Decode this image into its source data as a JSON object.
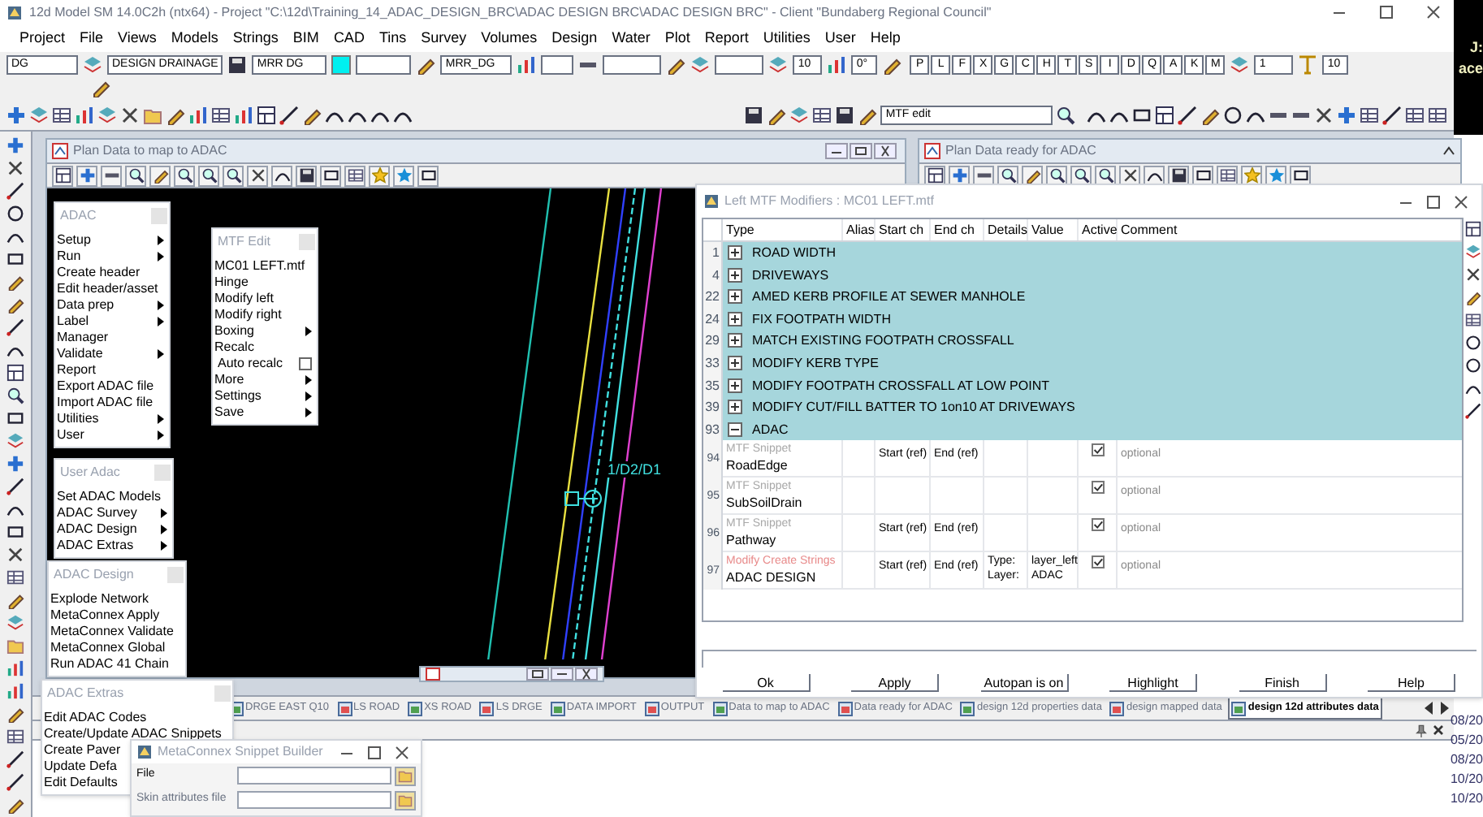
{
  "window": {
    "title": "12d Model SM 14.0C2h (ntx64) - Project \"C:\\12d\\Training_14_ADAC_DESIGN_BRC\\ADAC DESIGN BRC\\ADAC DESIGN BRC\" - Client \"Bundaberg Regional Council\""
  },
  "menu": [
    "Project",
    "File",
    "Views",
    "Models",
    "Strings",
    "BIM",
    "CAD",
    "Tins",
    "Survey",
    "Volumes",
    "Design",
    "Water",
    "Plot",
    "Report",
    "Utilities",
    "User",
    "Help"
  ],
  "attribute_fields": [
    "DG",
    "DESIGN DRAINAGE",
    "MRR DG",
    "MRR_DG",
    "10",
    "0°",
    "1",
    "10"
  ],
  "letter_buttons": [
    "P",
    "L",
    "F",
    "X",
    "G",
    "C",
    "H",
    "T",
    "S",
    "I",
    "D",
    "Q",
    "A",
    "K",
    "M"
  ],
  "mtf_search": {
    "value": "MTF edit"
  },
  "plan_windows": [
    {
      "title": "Plan Data to map to ADAC",
      "canvas_label": "1/D2/D1"
    },
    {
      "title": "Plan Data ready for ADAC"
    }
  ],
  "menus": [
    {
      "title": "ADAC",
      "items": [
        {
          "label": "Setup",
          "submenu": true
        },
        {
          "label": "Run",
          "submenu": true
        },
        {
          "label": "Create header",
          "submenu": false
        },
        {
          "label": "Edit header/asset",
          "submenu": false
        },
        {
          "label": "Data prep",
          "submenu": true
        },
        {
          "label": "Label",
          "submenu": true
        },
        {
          "label": "Manager",
          "submenu": false
        },
        {
          "label": "Validate",
          "submenu": true
        },
        {
          "label": "Report",
          "submenu": false
        },
        {
          "label": "Export ADAC file",
          "submenu": false
        },
        {
          "label": "Import ADAC file",
          "submenu": false
        },
        {
          "label": "Utilities",
          "submenu": true
        },
        {
          "label": "User",
          "submenu": true
        }
      ]
    },
    {
      "title": "MTF Edit",
      "items": [
        {
          "label": "MC01 LEFT.mtf",
          "kind": "item",
          "submenu": false
        },
        {
          "label": "Hinge",
          "kind": "item",
          "submenu": false
        },
        {
          "label": "Modify left",
          "kind": "item",
          "submenu": false
        },
        {
          "label": "Modify right",
          "kind": "item",
          "submenu": false
        },
        {
          "label": "Boxing",
          "kind": "item",
          "submenu": true
        },
        {
          "label": "Recalc",
          "kind": "item",
          "submenu": false
        },
        {
          "label": "Auto recalc",
          "kind": "checkbox",
          "checked": false
        },
        {
          "label": "More",
          "kind": "item",
          "submenu": true
        },
        {
          "label": "Settings",
          "kind": "item",
          "submenu": true
        },
        {
          "label": "Save",
          "kind": "item",
          "submenu": true
        }
      ]
    },
    {
      "title": "User Adac",
      "items": [
        {
          "label": "Set ADAC Models",
          "submenu": false
        },
        {
          "label": "ADAC Survey",
          "submenu": true
        },
        {
          "label": "ADAC Design",
          "submenu": true
        },
        {
          "label": "ADAC Extras",
          "submenu": true
        }
      ]
    },
    {
      "title": "ADAC Design",
      "items": [
        {
          "label": "Explode Network",
          "submenu": false
        },
        {
          "label": "MetaConnex Apply",
          "submenu": false
        },
        {
          "label": "MetaConnex Validate",
          "submenu": false
        },
        {
          "label": "MetaConnex Global",
          "submenu": false
        },
        {
          "label": "Run ADAC 41 Chain",
          "submenu": false
        }
      ]
    },
    {
      "title": "ADAC Extras",
      "items": [
        {
          "label": "Edit ADAC Codes",
          "submenu": false
        },
        {
          "label": "Create/Update ADAC Snippets",
          "submenu": false
        },
        {
          "label": "Create Paver",
          "submenu": false
        },
        {
          "label": "Update Defa",
          "submenu": false
        },
        {
          "label": "Edit Defaults",
          "submenu": false
        }
      ]
    }
  ],
  "mtf_dialog": {
    "title": "Left MTF Modifiers : MC01 LEFT.mtf",
    "columns": [
      "Type",
      "Alias",
      "Start ch",
      "End ch",
      "Details",
      "Value",
      "Active",
      "Comment"
    ],
    "rows": [
      {
        "kind": "group",
        "number": "1",
        "label": "ROAD WIDTH",
        "expanded": false
      },
      {
        "kind": "group",
        "number": "4",
        "label": "DRIVEWAYS",
        "expanded": false
      },
      {
        "kind": "group",
        "number": "22",
        "label": "AMED KERB PROFILE AT SEWER MANHOLE",
        "expanded": false
      },
      {
        "kind": "group",
        "number": "24",
        "label": "FIX FOOTPATH WIDTH",
        "expanded": false
      },
      {
        "kind": "group",
        "number": "29",
        "label": "MATCH EXISTING FOOTPATH CROSSFALL",
        "expanded": false
      },
      {
        "kind": "group",
        "number": "33",
        "label": "MODIFY KERB TYPE",
        "expanded": false
      },
      {
        "kind": "group",
        "number": "35",
        "label": "MODIFY FOOTPATH CROSSFALL AT LOW POINT",
        "expanded": false
      },
      {
        "kind": "group",
        "number": "39",
        "label": "MODIFY CUT/FILL BATTER TO 1on10 AT DRIVEWAYS",
        "expanded": false
      },
      {
        "kind": "group",
        "number": "93",
        "label": "ADAC",
        "expanded": true
      },
      {
        "kind": "snippet",
        "number": "94",
        "type": "MTF Snippet",
        "color": "#a8a8a8",
        "name": "RoadEdge",
        "start": "Start (ref)",
        "end": "End (ref)",
        "active": true,
        "comment": "optional"
      },
      {
        "kind": "snippet",
        "number": "95",
        "type": "MTF Snippet",
        "color": "#a8a8a8",
        "name": "SubSoilDrain",
        "active": true,
        "comment": "optional"
      },
      {
        "kind": "snippet",
        "number": "96",
        "type": "MTF Snippet",
        "color": "#a8a8a8",
        "name": "Pathway",
        "start": "Start (ref)",
        "end": "End (ref)",
        "active": true,
        "comment": "optional"
      },
      {
        "kind": "snippet",
        "number": "97",
        "type": "Modify Create Strings",
        "color": "#e88a8a",
        "name": "ADAC DESIGN",
        "start": "Start (ref)",
        "end": "End (ref)",
        "details": [
          "Type:",
          "Layer:"
        ],
        "value": [
          "layer_left",
          "ADAC"
        ],
        "active": true,
        "comment": "optional"
      }
    ],
    "buttons": [
      "Ok",
      "Apply",
      "Autopan is on",
      "Highlight",
      "Finish",
      "Help"
    ]
  },
  "tabs": [
    {
      "label": "DRGE EAST Q10",
      "selected": false
    },
    {
      "label": "LS ROAD",
      "selected": false
    },
    {
      "label": "XS ROAD",
      "selected": false
    },
    {
      "label": "LS DRGE",
      "selected": false
    },
    {
      "label": "DATA IMPORT",
      "selected": false
    },
    {
      "label": "OUTPUT",
      "selected": false
    },
    {
      "label": "Data to map to ADAC",
      "selected": false
    },
    {
      "label": "Data ready for ADAC",
      "selected": false
    },
    {
      "label": "design 12d properties data",
      "selected": false
    },
    {
      "label": "design mapped data",
      "selected": false
    },
    {
      "label": "design 12d attributes data",
      "selected": true
    }
  ],
  "snippet_builder": {
    "title": "MetaConnex Snippet Builder",
    "fields": [
      {
        "label": "File"
      },
      {
        "label": "Skin attributes file"
      }
    ]
  },
  "side_window": {
    "texts": [
      "J:",
      "ace"
    ],
    "dates": [
      "08/20",
      "05/20",
      "08/20",
      "10/20",
      "10/20"
    ]
  }
}
